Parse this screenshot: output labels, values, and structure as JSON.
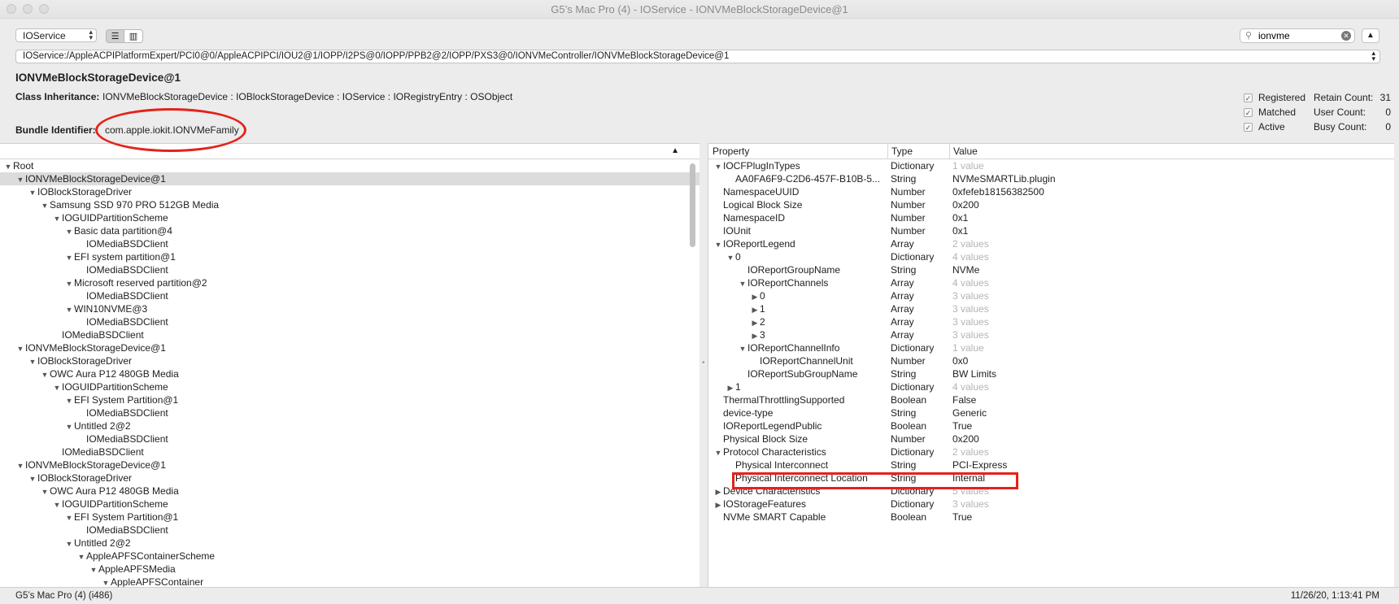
{
  "window": {
    "title": "G5’s Mac Pro (4) - IOService - IONVMeBlockStorageDevice@1"
  },
  "toolbar": {
    "plane": "IOService",
    "search_value": "ionvme"
  },
  "path": "IOService:/AppleACPIPlatformExpert/PCI0@0/AppleACPIPCI/IOU2@1/IOPP/I2PS@0/IOPP/PPB2@2/IOPP/PXS3@0/IONVMeController/IONVMeBlockStorageDevice@1",
  "object": {
    "title": "IONVMeBlockStorageDevice@1",
    "class_label": "Class Inheritance:",
    "class_value": "IONVMeBlockStorageDevice : IOBlockStorageDevice : IOService : IORegistryEntry : OSObject",
    "bundle_label": "Bundle Identifier:",
    "bundle_value": "com.apple.iokit.IONVMeFamily",
    "flags": [
      {
        "label": "Registered",
        "checked": true
      },
      {
        "label": "Matched",
        "checked": true
      },
      {
        "label": "Active",
        "checked": true
      }
    ],
    "counts": [
      {
        "label": "Retain Count:",
        "value": "31"
      },
      {
        "label": "User Count:",
        "value": "0"
      },
      {
        "label": "Busy Count:",
        "value": "0"
      }
    ]
  },
  "tree": [
    {
      "depth": 0,
      "expanded": true,
      "label": "Root"
    },
    {
      "depth": 1,
      "expanded": true,
      "label": "IONVMeBlockStorageDevice@1",
      "selected": true
    },
    {
      "depth": 2,
      "expanded": true,
      "label": "IOBlockStorageDriver"
    },
    {
      "depth": 3,
      "expanded": true,
      "label": "Samsung SSD 970 PRO 512GB Media"
    },
    {
      "depth": 4,
      "expanded": true,
      "label": "IOGUIDPartitionScheme"
    },
    {
      "depth": 5,
      "expanded": true,
      "label": "Basic data partition@4"
    },
    {
      "depth": 6,
      "label": "IOMediaBSDClient"
    },
    {
      "depth": 5,
      "expanded": true,
      "label": "EFI system partition@1"
    },
    {
      "depth": 6,
      "label": "IOMediaBSDClient"
    },
    {
      "depth": 5,
      "expanded": true,
      "label": "Microsoft reserved partition@2"
    },
    {
      "depth": 6,
      "label": "IOMediaBSDClient"
    },
    {
      "depth": 5,
      "expanded": true,
      "label": "WIN10NVME@3"
    },
    {
      "depth": 6,
      "label": "IOMediaBSDClient"
    },
    {
      "depth": 4,
      "label": "IOMediaBSDClient"
    },
    {
      "depth": 1,
      "expanded": true,
      "label": "IONVMeBlockStorageDevice@1"
    },
    {
      "depth": 2,
      "expanded": true,
      "label": "IOBlockStorageDriver"
    },
    {
      "depth": 3,
      "expanded": true,
      "label": "OWC Aura P12 480GB Media"
    },
    {
      "depth": 4,
      "expanded": true,
      "label": "IOGUIDPartitionScheme"
    },
    {
      "depth": 5,
      "expanded": true,
      "label": "EFI System Partition@1"
    },
    {
      "depth": 6,
      "label": "IOMediaBSDClient"
    },
    {
      "depth": 5,
      "expanded": true,
      "label": "Untitled 2@2"
    },
    {
      "depth": 6,
      "label": "IOMediaBSDClient"
    },
    {
      "depth": 4,
      "label": "IOMediaBSDClient"
    },
    {
      "depth": 1,
      "expanded": true,
      "label": "IONVMeBlockStorageDevice@1"
    },
    {
      "depth": 2,
      "expanded": true,
      "label": "IOBlockStorageDriver"
    },
    {
      "depth": 3,
      "expanded": true,
      "label": "OWC Aura P12 480GB Media"
    },
    {
      "depth": 4,
      "expanded": true,
      "label": "IOGUIDPartitionScheme"
    },
    {
      "depth": 5,
      "expanded": true,
      "label": "EFI System Partition@1"
    },
    {
      "depth": 6,
      "label": "IOMediaBSDClient"
    },
    {
      "depth": 5,
      "expanded": true,
      "label": "Untitled 2@2"
    },
    {
      "depth": 6,
      "expanded": true,
      "label": "AppleAPFSContainerScheme"
    },
    {
      "depth": 7,
      "expanded": true,
      "label": "AppleAPFSMedia"
    },
    {
      "depth": 8,
      "expanded": true,
      "label": "AppleAPFSContainer"
    }
  ],
  "properties": {
    "columns": [
      "Property",
      "Type",
      "Value"
    ],
    "rows": [
      {
        "depth": 0,
        "tri": "open",
        "name": "IOCFPlugInTypes",
        "type": "Dictionary",
        "value": "1 value",
        "dim": true
      },
      {
        "depth": 1,
        "name": "AA0FA6F9-C2D6-457F-B10B-5...",
        "type": "String",
        "value": "NVMeSMARTLib.plugin"
      },
      {
        "depth": 0,
        "name": "NamespaceUUID",
        "type": "Number",
        "value": "0xfefeb18156382500"
      },
      {
        "depth": 0,
        "name": "Logical Block Size",
        "type": "Number",
        "value": "0x200"
      },
      {
        "depth": 0,
        "name": "NamespaceID",
        "type": "Number",
        "value": "0x1"
      },
      {
        "depth": 0,
        "name": "IOUnit",
        "type": "Number",
        "value": "0x1"
      },
      {
        "depth": 0,
        "tri": "open",
        "name": "IOReportLegend",
        "type": "Array",
        "value": "2 values",
        "dim": true
      },
      {
        "depth": 1,
        "tri": "open",
        "name": "0",
        "type": "Dictionary",
        "value": "4 values",
        "dim": true
      },
      {
        "depth": 2,
        "name": "IOReportGroupName",
        "type": "String",
        "value": "NVMe"
      },
      {
        "depth": 2,
        "tri": "open",
        "name": "IOReportChannels",
        "type": "Array",
        "value": "4 values",
        "dim": true
      },
      {
        "depth": 3,
        "tri": "closed",
        "name": "0",
        "type": "Array",
        "value": "3 values",
        "dim": true
      },
      {
        "depth": 3,
        "tri": "closed",
        "name": "1",
        "type": "Array",
        "value": "3 values",
        "dim": true
      },
      {
        "depth": 3,
        "tri": "closed",
        "name": "2",
        "type": "Array",
        "value": "3 values",
        "dim": true
      },
      {
        "depth": 3,
        "tri": "closed",
        "name": "3",
        "type": "Array",
        "value": "3 values",
        "dim": true
      },
      {
        "depth": 2,
        "tri": "open",
        "name": "IOReportChannelInfo",
        "type": "Dictionary",
        "value": "1 value",
        "dim": true
      },
      {
        "depth": 3,
        "name": "IOReportChannelUnit",
        "type": "Number",
        "value": "0x0"
      },
      {
        "depth": 2,
        "name": "IOReportSubGroupName",
        "type": "String",
        "value": "BW Limits"
      },
      {
        "depth": 1,
        "tri": "closed",
        "name": "1",
        "type": "Dictionary",
        "value": "4 values",
        "dim": true
      },
      {
        "depth": 0,
        "name": "ThermalThrottlingSupported",
        "type": "Boolean",
        "value": "False"
      },
      {
        "depth": 0,
        "name": "device-type",
        "type": "String",
        "value": "Generic"
      },
      {
        "depth": 0,
        "name": "IOReportLegendPublic",
        "type": "Boolean",
        "value": "True"
      },
      {
        "depth": 0,
        "name": "Physical Block Size",
        "type": "Number",
        "value": "0x200"
      },
      {
        "depth": 0,
        "tri": "open",
        "name": "Protocol Characteristics",
        "type": "Dictionary",
        "value": "2 values",
        "dim": true
      },
      {
        "depth": 1,
        "name": "Physical Interconnect",
        "type": "String",
        "value": "PCI-Express"
      },
      {
        "depth": 1,
        "name": "Physical Interconnect Location",
        "type": "String",
        "value": "Internal"
      },
      {
        "depth": 0,
        "tri": "closed",
        "name": "Device Characteristics",
        "type": "Dictionary",
        "value": "5 values",
        "dim": true
      },
      {
        "depth": 0,
        "tri": "closed",
        "name": "IOStorageFeatures",
        "type": "Dictionary",
        "value": "3 values",
        "dim": true
      },
      {
        "depth": 0,
        "name": "NVMe SMART Capable",
        "type": "Boolean",
        "value": "True"
      }
    ]
  },
  "status": {
    "left": "G5’s Mac Pro (4) (i486)",
    "right": "11/26/20, 1:13:41 PM"
  },
  "colors": {
    "annotation": "#e3231b",
    "selection": "#dcdcdc",
    "dim_text": "#b3b3b3"
  }
}
